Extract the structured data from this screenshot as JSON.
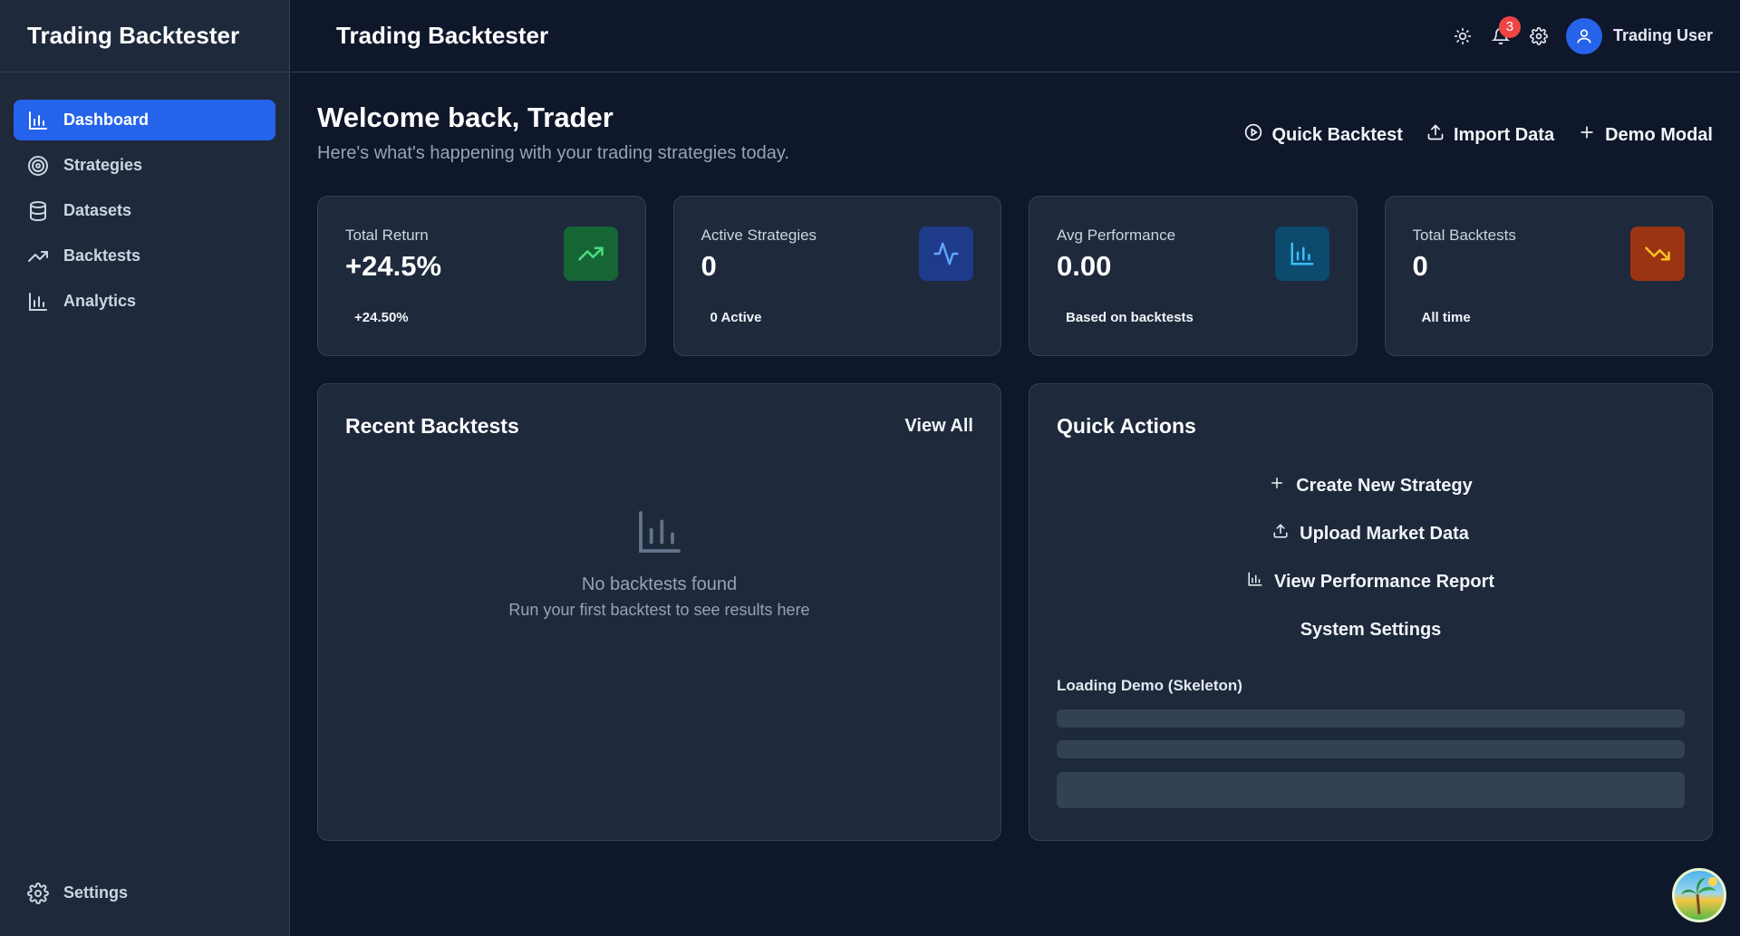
{
  "sidebar": {
    "brand": "Trading Backtester",
    "items": [
      {
        "label": "Dashboard",
        "icon": "bar-chart-icon",
        "active": true
      },
      {
        "label": "Strategies",
        "icon": "target-icon"
      },
      {
        "label": "Datasets",
        "icon": "database-icon"
      },
      {
        "label": "Backtests",
        "icon": "trending-up-icon"
      },
      {
        "label": "Analytics",
        "icon": "bar-chart-icon"
      }
    ],
    "footer": {
      "label": "Settings",
      "icon": "gear-icon"
    }
  },
  "topbar": {
    "title": "Trading Backtester",
    "notification_count": "3",
    "user_name": "Trading User"
  },
  "welcome": {
    "title": "Welcome back, Trader",
    "subtitle": "Here's what's happening with your trading strategies today."
  },
  "header_actions": {
    "quick_backtest": "Quick Backtest",
    "import_data": "Import Data",
    "demo_modal": "Demo Modal"
  },
  "stats": [
    {
      "label": "Total Return",
      "value": "+24.5%",
      "note": "+24.50%",
      "icon": "trending-up-icon",
      "color": "#16a34a"
    },
    {
      "label": "Active Strategies",
      "value": "0",
      "note": "0 Active",
      "icon": "activity-icon",
      "color": "#2563eb"
    },
    {
      "label": "Avg Performance",
      "value": "0.00",
      "note": "Based on backtests",
      "icon": "bar-chart-icon",
      "color": "#0ea5e9"
    },
    {
      "label": "Total Backtests",
      "value": "0",
      "note": "All time",
      "icon": "trending-down-icon",
      "color": "#f59e0b"
    }
  ],
  "recent": {
    "title": "Recent Backtests",
    "view_all": "View All",
    "empty_title": "No backtests found",
    "empty_sub": "Run your first backtest to see results here"
  },
  "quick_actions": {
    "title": "Quick Actions",
    "items": [
      {
        "label": "Create New Strategy",
        "icon": "plus-icon"
      },
      {
        "label": "Upload Market Data",
        "icon": "upload-icon"
      },
      {
        "label": "View Performance Report",
        "icon": "bar-chart-icon"
      },
      {
        "label": "System Settings",
        "icon": ""
      }
    ],
    "loading_label": "Loading Demo (Skeleton)"
  }
}
